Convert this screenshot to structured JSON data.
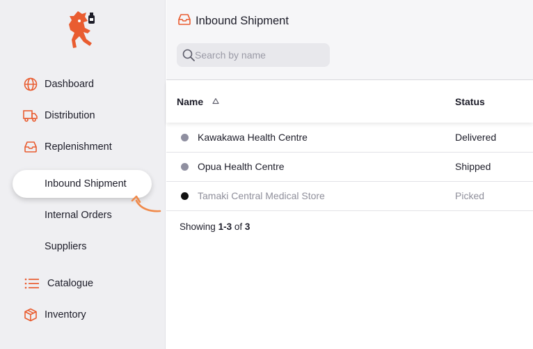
{
  "sidebar": {
    "items": [
      {
        "label": "Dashboard",
        "icon": "globe-icon"
      },
      {
        "label": "Distribution",
        "icon": "truck-icon"
      },
      {
        "label": "Replenishment",
        "icon": "inbox-icon"
      },
      {
        "label": "Inbound Shipment",
        "active": true
      },
      {
        "label": "Internal Orders"
      },
      {
        "label": "Suppliers"
      },
      {
        "label": "Catalogue",
        "icon": "list-icon"
      },
      {
        "label": "Inventory",
        "icon": "box-icon"
      }
    ]
  },
  "header": {
    "title": "Inbound Shipment",
    "search_placeholder": "Search by name"
  },
  "table": {
    "columns": {
      "name": "Name",
      "status": "Status"
    },
    "rows": [
      {
        "name": "Kawakawa Health Centre",
        "status": "Delivered",
        "dot_color": "#8f8fa0"
      },
      {
        "name": "Opua Health Centre",
        "status": "Shipped",
        "dot_color": "#8f8fa0"
      },
      {
        "name": "Tamaki Central Medical Store",
        "status": "Picked",
        "dot_color": "#111111"
      }
    ]
  },
  "footer": {
    "prefix": "Showing",
    "range": "1-3",
    "of": "of",
    "total": "3"
  },
  "colors": {
    "accent": "#e95c30",
    "arrow": "#f08a4b"
  }
}
